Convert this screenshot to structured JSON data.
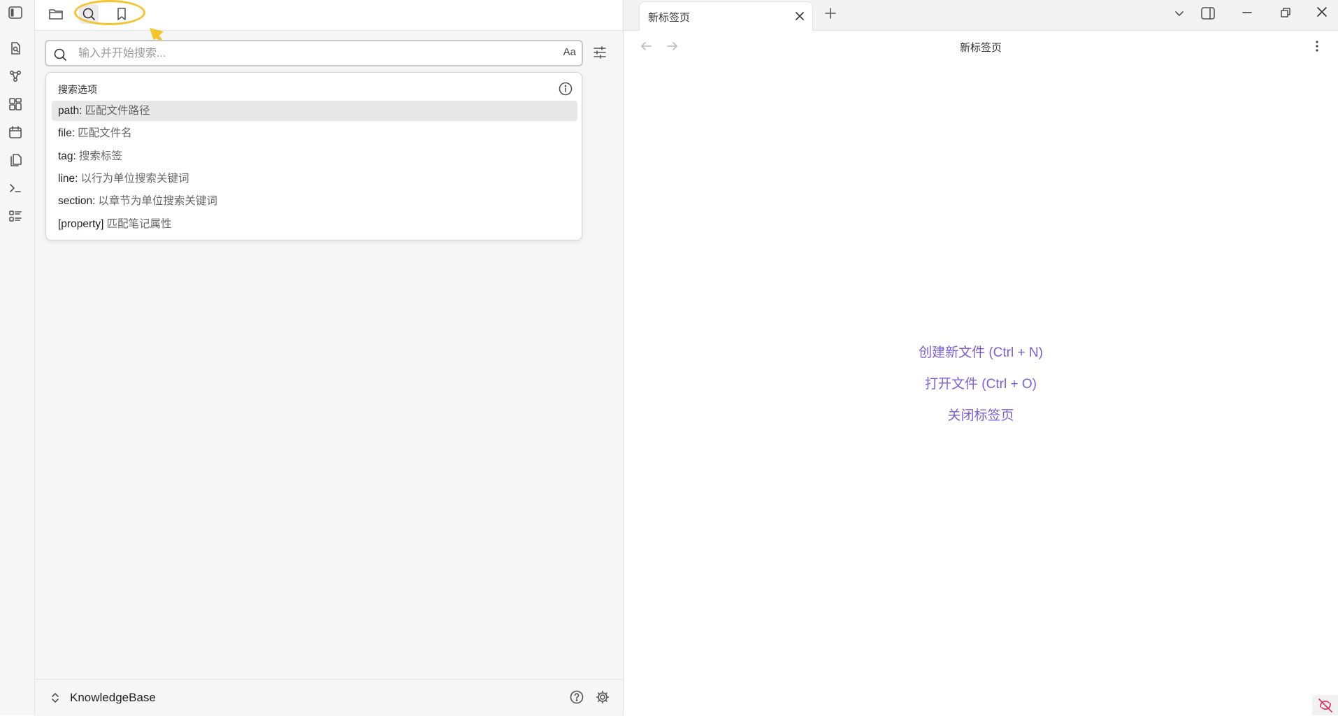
{
  "sidebar": {
    "search": {
      "placeholder": "输入并开始搜索...",
      "case_toggle": "Aa"
    },
    "options": {
      "title": "搜索选项",
      "items": [
        {
          "key": "path:",
          "desc": "匹配文件路径"
        },
        {
          "key": "file:",
          "desc": "匹配文件名"
        },
        {
          "key": "tag:",
          "desc": "搜索标签"
        },
        {
          "key": "line:",
          "desc": "以行为单位搜索关键词"
        },
        {
          "key": "section:",
          "desc": "以章节为单位搜索关键词"
        },
        {
          "key": "[property]",
          "desc": "匹配笔记属性"
        }
      ]
    },
    "vault_name": "KnowledgeBase"
  },
  "main": {
    "tab_title": "新标签页",
    "view_title": "新标签页",
    "empty_state": {
      "create": "创建新文件 (Ctrl + N)",
      "open": "打开文件 (Ctrl + O)",
      "close": "关闭标签页"
    }
  },
  "colors": {
    "accent": "#7b5fd6",
    "highlight": "#f5c32c"
  }
}
